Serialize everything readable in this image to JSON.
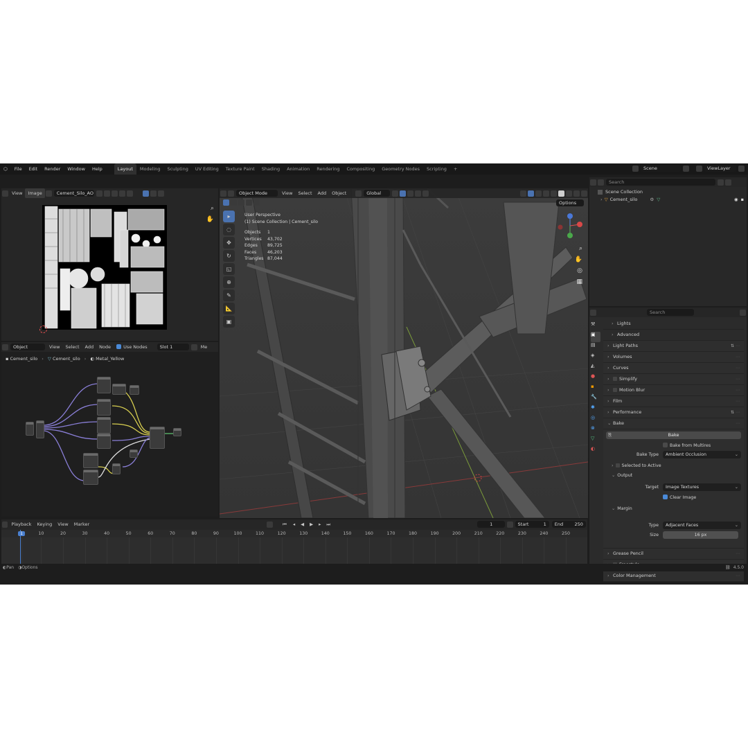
{
  "menu": [
    "File",
    "Edit",
    "Render",
    "Window",
    "Help"
  ],
  "workspaces": [
    "Layout",
    "Modeling",
    "Sculpting",
    "UV Editing",
    "Texture Paint",
    "Shading",
    "Animation",
    "Rendering",
    "Compositing",
    "Geometry Nodes",
    "Scripting",
    "+"
  ],
  "top_right": {
    "scene": "Scene",
    "view_layer": "ViewLayer"
  },
  "image_editor": {
    "view": "View",
    "image": "Image",
    "image_name": "Cement_Silo_AO"
  },
  "node_editor": {
    "mode": "Object",
    "menus": [
      "View",
      "Select",
      "Add",
      "Node"
    ],
    "use_nodes": "Use Nodes",
    "slot": "Slot 1",
    "trunc": "Me",
    "breadcrumb": [
      "Cement_silo",
      "Cement_silo",
      "Metal_Yellow"
    ]
  },
  "viewport": {
    "mode": "Object Mode",
    "menus": [
      "View",
      "Select",
      "Add",
      "Object"
    ],
    "orientation": "Global",
    "options": "Options",
    "title": "User Perspective",
    "collection": "(1) Scene Collection | Cement_silo",
    "stats": [
      {
        "label": "Objects",
        "value": "1"
      },
      {
        "label": "Vertices",
        "value": "43,702"
      },
      {
        "label": "Edges",
        "value": "89,725"
      },
      {
        "label": "Faces",
        "value": "46,203"
      },
      {
        "label": "Triangles",
        "value": "87,044"
      }
    ]
  },
  "outliner": {
    "search": "Search",
    "root": "Scene Collection",
    "object": "Cement_silo"
  },
  "properties": {
    "search": "Search",
    "sub_items": [
      "Lights",
      "Advanced"
    ],
    "sections": [
      "Light Paths",
      "Volumes",
      "Curves",
      "Simplify",
      "Motion Blur",
      "Film",
      "Performance",
      "Bake"
    ],
    "bake_button": "Bake",
    "bake_from_multires": "Bake from Multires",
    "bake_type_label": "Bake Type",
    "bake_type_value": "Ambient Occlusion",
    "selected_to_active": "Selected to Active",
    "output": "Output",
    "target_label": "Target",
    "target_value": "Image Textures",
    "clear_image": "Clear Image",
    "margin": "Margin",
    "type_label": "Type",
    "type_value": "Adjacent Faces",
    "size_label": "Size",
    "size_value": "16 px",
    "bottom_sections": [
      "Grease Pencil",
      "Freestyle",
      "Color Management"
    ]
  },
  "timeline": {
    "menus": [
      "Playback",
      "Keying",
      "View",
      "Marker"
    ],
    "current_frame": "1",
    "start_label": "Start",
    "start": "1",
    "end_label": "End",
    "end": "250",
    "ticks": [
      "1",
      "10",
      "20",
      "30",
      "40",
      "50",
      "60",
      "70",
      "80",
      "90",
      "100",
      "110",
      "120",
      "130",
      "140",
      "150",
      "160",
      "170",
      "180",
      "190",
      "200",
      "210",
      "220",
      "230",
      "240",
      "250"
    ]
  },
  "statusbar": {
    "left": [
      "Pan",
      "Options"
    ],
    "version": "4.5.0"
  },
  "colors": {
    "accent": "#4a72b0",
    "bg": "#1d1d1d",
    "panel": "#2b2b2b"
  }
}
